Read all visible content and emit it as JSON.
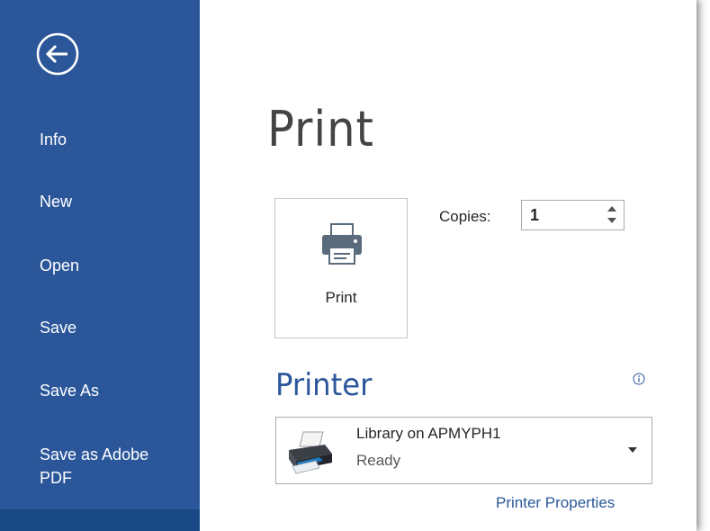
{
  "sidebar": {
    "back_icon": "back-arrow-icon",
    "items": [
      {
        "label": "Info"
      },
      {
        "label": "New"
      },
      {
        "label": "Open"
      },
      {
        "label": "Save"
      },
      {
        "label": "Save As"
      },
      {
        "label": "Save as Adobe PDF"
      }
    ]
  },
  "main": {
    "title": "Print",
    "print_button": {
      "label": "Print",
      "icon": "printer-icon"
    },
    "copies": {
      "label": "Copies:",
      "value": "1"
    },
    "printer_section": {
      "heading": "Printer",
      "info_icon": "info-icon",
      "selected_printer": {
        "name": "Library on APMYPH1",
        "status": "Ready"
      },
      "properties_link": "Printer Properties"
    }
  },
  "colors": {
    "sidebar_bg": "#2b579a",
    "accent": "#2b579a",
    "selected_item_bg": "#194a86"
  }
}
